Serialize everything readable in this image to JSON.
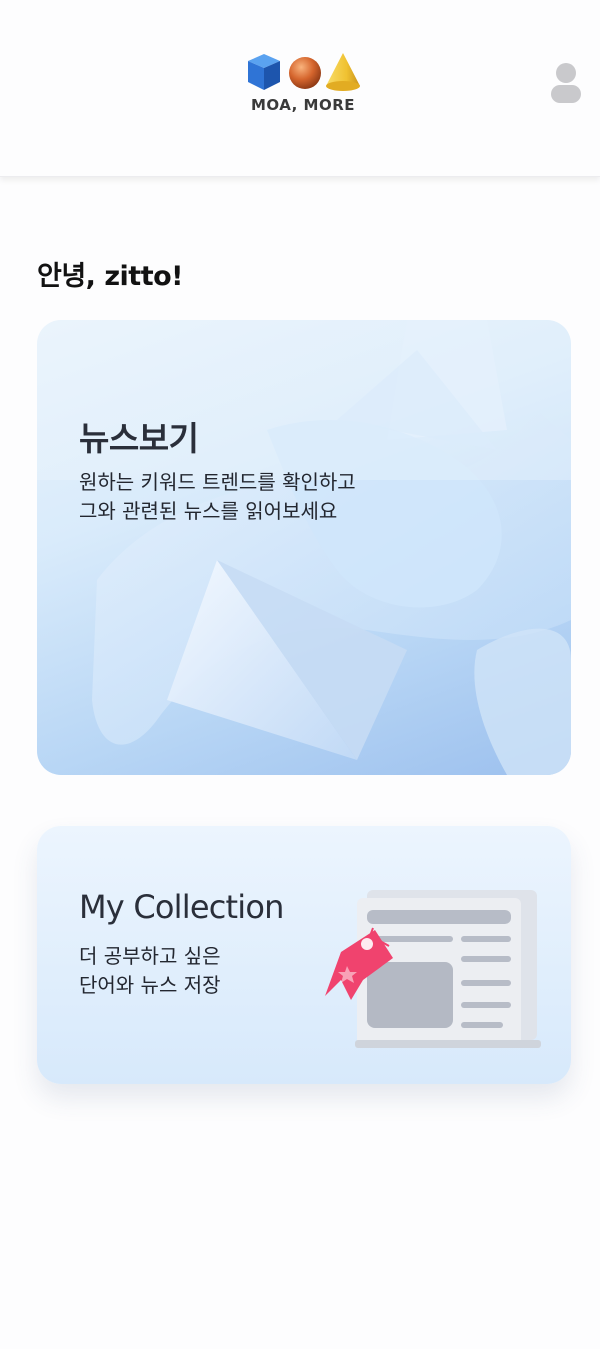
{
  "header": {
    "logo_text": "MOA, MORE"
  },
  "greeting": "안녕, zitto!",
  "cards": {
    "news": {
      "title": "뉴스보기",
      "desc_lines": [
        "원하는 키워드 트렌드를 확인하고",
        "그와 관련된 뉴스를 읽어보세요"
      ]
    },
    "collection": {
      "title": "My Collection",
      "desc_lines": [
        "더 공부하고 싶은",
        "단어와 뉴스 저장"
      ]
    }
  },
  "icons": {
    "logo_shapes": [
      "cube-icon",
      "sphere-icon",
      "cone-icon"
    ],
    "profile": "user-icon",
    "newspaper": "newspaper-icon",
    "bookmark": "bookmark-tag-icon"
  },
  "colors": {
    "background": "#fdfdfe",
    "cube": "#2f74d6",
    "sphere": "#d5652d",
    "cone": "#f0c232",
    "profile": "#c9c9cc",
    "bookmark": "#f0436e",
    "text": "#2a2f3a"
  }
}
